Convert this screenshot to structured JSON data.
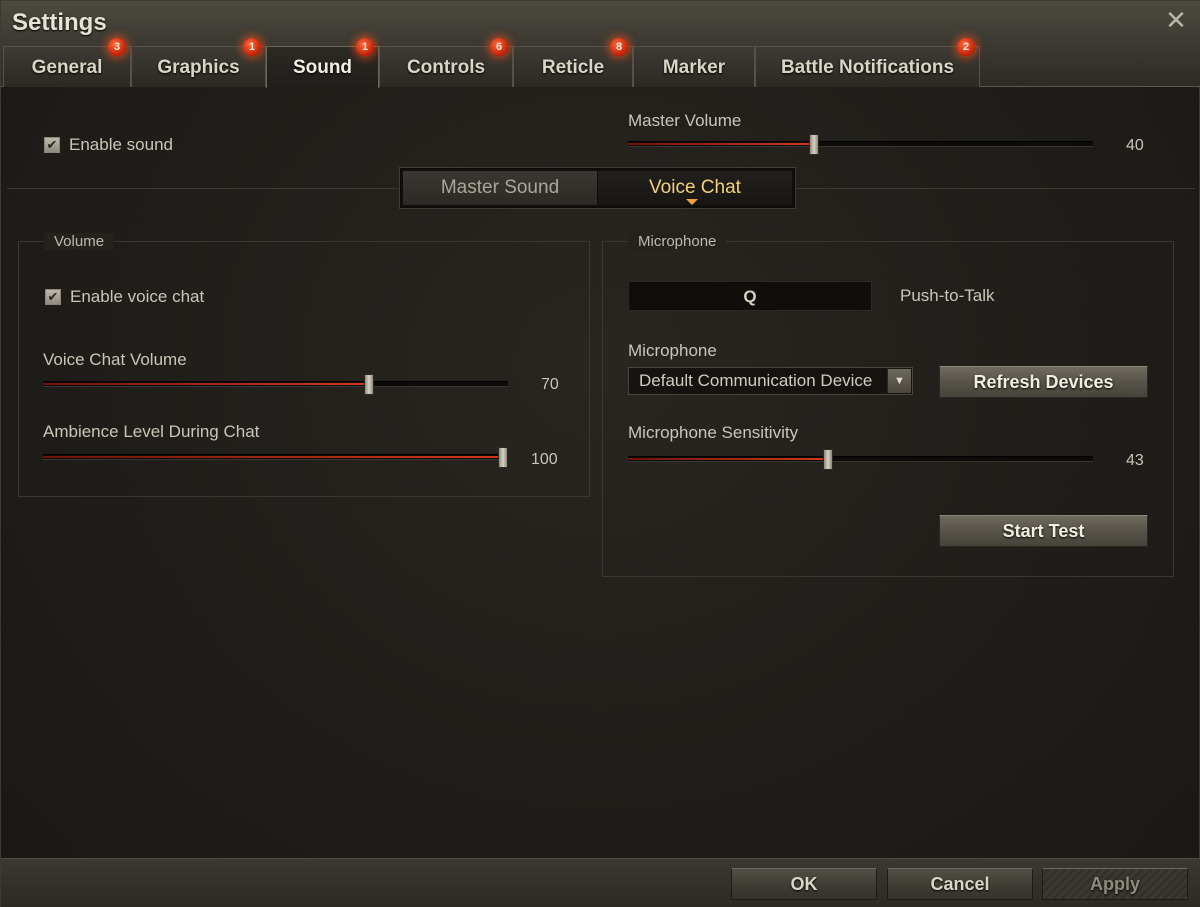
{
  "window": {
    "title": "Settings",
    "close_symbol": "✕"
  },
  "tabs": [
    {
      "label": "General",
      "badge": "3"
    },
    {
      "label": "Graphics",
      "badge": "1"
    },
    {
      "label": "Sound",
      "badge": "1",
      "active": true
    },
    {
      "label": "Controls",
      "badge": "6"
    },
    {
      "label": "Reticle",
      "badge": "8"
    },
    {
      "label": "Marker",
      "badge": ""
    },
    {
      "label": "Battle Notifications",
      "badge": "2"
    }
  ],
  "top": {
    "enable_sound": {
      "label": "Enable sound",
      "checked": true
    },
    "master_volume": {
      "label": "Master Volume",
      "value": "40",
      "level": 0.4
    }
  },
  "subtabs": {
    "master_sound": "Master Sound",
    "voice_chat": "Voice Chat",
    "active": "Voice Chat"
  },
  "volume_group": {
    "title": "Volume",
    "enable_voice_chat": {
      "label": "Enable voice chat",
      "checked": true
    },
    "voice_chat_volume": {
      "label": "Voice Chat Volume",
      "value": "70",
      "level": 0.7
    },
    "ambience_level": {
      "label": "Ambience Level During Chat",
      "value": "100",
      "level": 1.0
    }
  },
  "microphone_group": {
    "title": "Microphone",
    "push_to_talk_key": "Q",
    "push_to_talk_label": "Push-to-Talk",
    "device_label": "Microphone",
    "device_selected": "Default Communication Device",
    "refresh_button": "Refresh Devices",
    "sensitivity": {
      "label": "Microphone Sensitivity",
      "value": "43",
      "level": 0.43
    },
    "start_test_button": "Start Test"
  },
  "footer": {
    "ok": "OK",
    "cancel": "Cancel",
    "apply": "Apply"
  },
  "icons": {
    "check": "✔",
    "dropdown_arrow": "▼"
  },
  "colors": {
    "accent_red": "#d0391a",
    "badge": "#e8401a",
    "active_subtab": "#f3cf7a"
  }
}
